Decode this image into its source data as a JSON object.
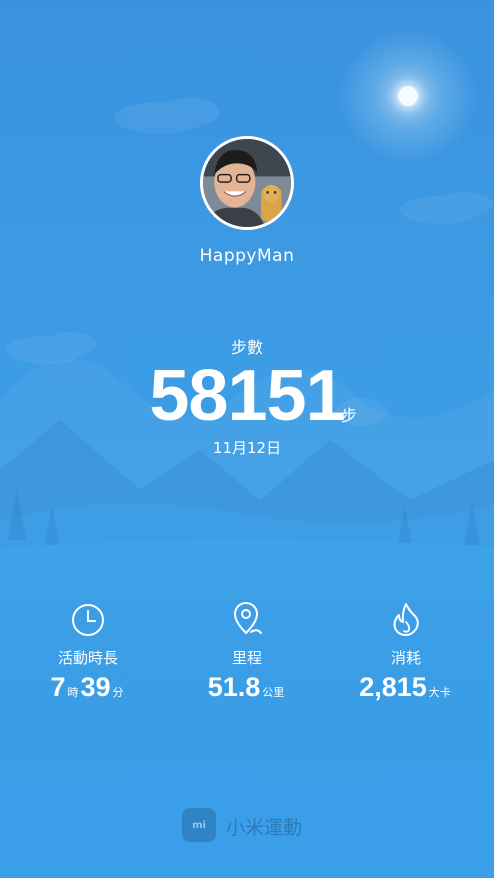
{
  "profile": {
    "username": "HappyMan"
  },
  "steps": {
    "label": "步數",
    "value": "58151",
    "unit": "步",
    "date": "11月12日"
  },
  "stats": [
    {
      "icon": "clock-icon",
      "label": "活動時長",
      "hours": "7",
      "hours_unit": "時",
      "minutes": "39",
      "minutes_unit": "分"
    },
    {
      "icon": "location-pin-icon",
      "label": "里程",
      "value": "51.8",
      "unit": "公里"
    },
    {
      "icon": "flame-icon",
      "label": "消耗",
      "value": "2,815",
      "unit": "大卡"
    }
  ],
  "brand": {
    "logo_text": "mi",
    "name": "小米運動"
  },
  "colors": {
    "background_top": "#3a93df",
    "background_bottom": "#3a9fe8",
    "text": "#ffffff"
  }
}
